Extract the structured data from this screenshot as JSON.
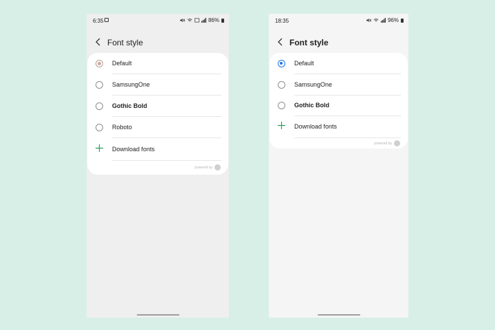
{
  "left": {
    "status": {
      "time": "6:35",
      "battery": "86%"
    },
    "title": "Font style",
    "items": [
      {
        "label": "Default",
        "type": "radio",
        "selected": true
      },
      {
        "label": "SamsungOne",
        "type": "radio",
        "selected": false
      },
      {
        "label": "Gothic Bold",
        "type": "radio",
        "selected": false
      },
      {
        "label": "Roboto",
        "type": "radio",
        "selected": false
      },
      {
        "label": "Download fonts",
        "type": "action",
        "icon": "plus-icon"
      }
    ],
    "powered_by": "powered by"
  },
  "right": {
    "status": {
      "time": "18:35",
      "battery": "96%"
    },
    "title": "Font style",
    "items": [
      {
        "label": "Default",
        "type": "radio",
        "selected": true
      },
      {
        "label": "SamsungOne",
        "type": "radio",
        "selected": false
      },
      {
        "label": "Gothic Bold",
        "type": "radio",
        "selected": false
      },
      {
        "label": "Download fonts",
        "type": "action",
        "icon": "plus-icon"
      }
    ],
    "powered_by": "powered by"
  },
  "colors": {
    "background": "#d8efe7",
    "left_selected": "#c9a89d",
    "right_selected": "#1a73e8",
    "plus": "#2e9e5a"
  }
}
